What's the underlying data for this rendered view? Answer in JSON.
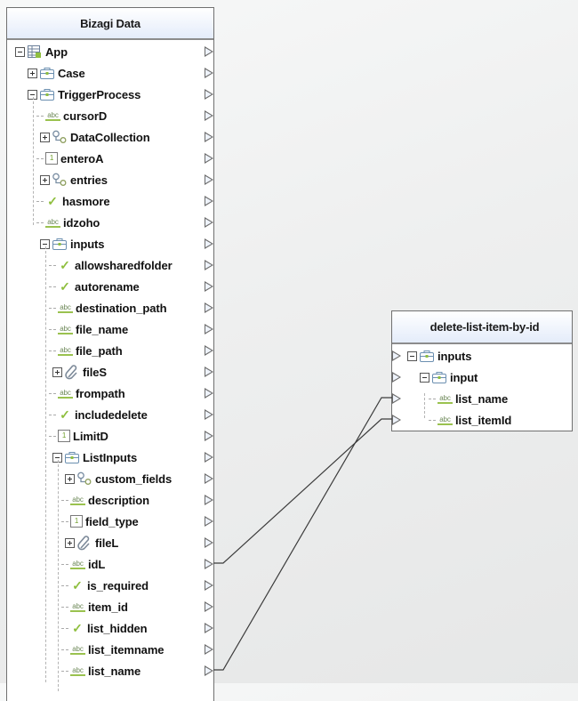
{
  "source_panel": {
    "title": "Bizagi Data",
    "rows": [
      {
        "label": "App",
        "icon": "entity-table-icon",
        "toggle": "collapse",
        "indent": 0
      },
      {
        "label": "Case",
        "icon": "briefcase-icon",
        "toggle": "expand",
        "indent": 1
      },
      {
        "label": "TriggerProcess",
        "icon": "briefcase-icon",
        "toggle": "collapse",
        "indent": 1
      },
      {
        "label": "cursorD",
        "icon": "string-icon",
        "toggle": "none",
        "indent": 2
      },
      {
        "label": "DataCollection",
        "icon": "collection-icon",
        "toggle": "expand",
        "indent": 2
      },
      {
        "label": "enteroA",
        "icon": "integer-icon",
        "toggle": "none",
        "indent": 2
      },
      {
        "label": "entries",
        "icon": "collection-icon",
        "toggle": "expand",
        "indent": 2
      },
      {
        "label": "hasmore",
        "icon": "boolean-icon",
        "toggle": "none",
        "indent": 2
      },
      {
        "label": "idzoho",
        "icon": "string-icon",
        "toggle": "none",
        "indent": 2
      },
      {
        "label": "inputs",
        "icon": "briefcase-icon",
        "toggle": "collapse",
        "indent": 2
      },
      {
        "label": "allowsharedfolder",
        "icon": "boolean-icon",
        "toggle": "none",
        "indent": 3
      },
      {
        "label": "autorename",
        "icon": "boolean-icon",
        "toggle": "none",
        "indent": 3
      },
      {
        "label": "destination_path",
        "icon": "string-icon",
        "toggle": "none",
        "indent": 3
      },
      {
        "label": "file_name",
        "icon": "string-icon",
        "toggle": "none",
        "indent": 3
      },
      {
        "label": "file_path",
        "icon": "string-icon",
        "toggle": "none",
        "indent": 3
      },
      {
        "label": "fileS",
        "icon": "attachment-icon",
        "toggle": "expand",
        "indent": 3
      },
      {
        "label": "frompath",
        "icon": "string-icon",
        "toggle": "none",
        "indent": 3
      },
      {
        "label": "includedelete",
        "icon": "boolean-icon",
        "toggle": "none",
        "indent": 3
      },
      {
        "label": "LimitD",
        "icon": "integer-icon",
        "toggle": "none",
        "indent": 3
      },
      {
        "label": "ListInputs",
        "icon": "briefcase-icon",
        "toggle": "collapse",
        "indent": 3
      },
      {
        "label": "custom_fields",
        "icon": "collection-icon",
        "toggle": "expand",
        "indent": 4
      },
      {
        "label": "description",
        "icon": "string-icon",
        "toggle": "none",
        "indent": 4
      },
      {
        "label": "field_type",
        "icon": "integer-icon",
        "toggle": "none",
        "indent": 4
      },
      {
        "label": "fileL",
        "icon": "attachment-icon",
        "toggle": "expand",
        "indent": 4
      },
      {
        "label": "idL",
        "icon": "string-icon",
        "toggle": "none",
        "indent": 4
      },
      {
        "label": "is_required",
        "icon": "boolean-icon",
        "toggle": "none",
        "indent": 4
      },
      {
        "label": "item_id",
        "icon": "string-icon",
        "toggle": "none",
        "indent": 4
      },
      {
        "label": "list_hidden",
        "icon": "boolean-icon",
        "toggle": "none",
        "indent": 4
      },
      {
        "label": "list_itemname",
        "icon": "string-icon",
        "toggle": "none",
        "indent": 4
      },
      {
        "label": "list_name",
        "icon": "string-icon",
        "toggle": "none",
        "indent": 4
      }
    ]
  },
  "target_panel": {
    "title": "delete-list-item-by-id",
    "rows": [
      {
        "label": "inputs",
        "icon": "briefcase-icon",
        "toggle": "collapse",
        "indent": 0
      },
      {
        "label": "input",
        "icon": "briefcase-icon",
        "toggle": "collapse",
        "indent": 1
      },
      {
        "label": "list_name",
        "icon": "string-icon",
        "toggle": "none",
        "indent": 2
      },
      {
        "label": "list_itemId",
        "icon": "string-icon",
        "toggle": "none",
        "indent": 2
      }
    ]
  },
  "mappings": [
    {
      "from": "idL",
      "to": "list_itemId"
    },
    {
      "from": "list_name",
      "to": "list_name"
    }
  ],
  "colors": {
    "wire": "#3c3c3c",
    "header_gradient_end": "#e4ecfa",
    "accent_green": "#8fbf3f"
  }
}
